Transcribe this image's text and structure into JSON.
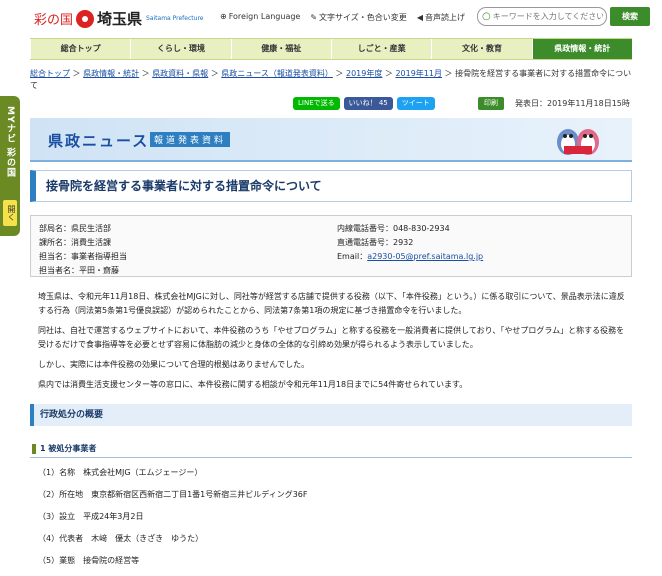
{
  "side": {
    "label": "MYナビ 彩の国",
    "open": "開く"
  },
  "header": {
    "brand_sai": "彩の国",
    "brand_pref": "埼玉県",
    "brand_en": "Saitama Prefecture",
    "links": [
      "Foreign Language",
      "文字サイズ・色合い変更",
      "音声読上げ"
    ],
    "search_placeholder": "キーワードを入力してください",
    "search_button": "検索"
  },
  "nav": [
    "総合トップ",
    "くらし・環境",
    "健康・福祉",
    "しごと・産業",
    "文化・教育",
    "県政情報・統計"
  ],
  "breadcrumb": {
    "items": [
      "総合トップ",
      "県政情報・統計",
      "県政資料・県報",
      "県政ニュース（報道発表資料）",
      "2019年度",
      "2019年11月"
    ],
    "current": "接骨院を経営する事業者に対する措置命令について"
  },
  "share": {
    "line": "LINEで送る",
    "fb": "いいね！ 45",
    "tw": "ツイート"
  },
  "print": "印刷",
  "published": "発表日：2019年11月18日15時",
  "banner": {
    "title": "県政ニュース",
    "tag": "報道発表資料"
  },
  "title": "接骨院を経営する事業者に対する措置命令について",
  "contact": {
    "left": [
      "部局名：県民生活部",
      "課所名：消費生活課",
      "担当名：事業者指導担当",
      "担当者名：平田・齋藤"
    ],
    "right": [
      "内線電話番号：048-830-2934",
      "直通電話番号：2932"
    ],
    "email_label": "Email：",
    "email": "a2930-05@pref.saitama.lg.jp"
  },
  "body": [
    "埼玉県は、令和元年11月18日、株式会社MJGに対し、同社等が経営する店舗で提供する役務（以下、「本件役務」という。）に係る取引について、景品表示法に違反する行為（同法第5条第1号優良誤認）が認められたことから、同法第7条第1項の規定に基づき措置命令を行いました。",
    "同社は、自社で運営するウェブサイトにおいて、本件役務のうち「やせプログラム」と称する役務を一般消費者に提供しており、「やせプログラム」と称する役務を受けるだけで食事指導等を必要とせず容易に体脂肪の減少と身体の全体的な引締め効果が得られるよう表示していました。",
    "しかし、実際には本件役務の効果について合理的根拠はありませんでした。",
    "県内では消費生活支援センター等の窓口に、本件役務に関する相談が令和元年11月18日までに54件寄せられています。"
  ],
  "section_title": "行政処分の概要",
  "subsection_title": "1 被処分事業者",
  "items": [
    "（1）名称　株式会社MJG（エムジェージー）",
    "（2）所在地　東京都新宿区西新宿二丁目1番1号新宿三井ビルディング36F",
    "（3）設立　平成24年3月2日",
    "（4）代表者　木﨑　優太（きざき　ゆうた）",
    "（5）業態　接骨院の経営等"
  ]
}
